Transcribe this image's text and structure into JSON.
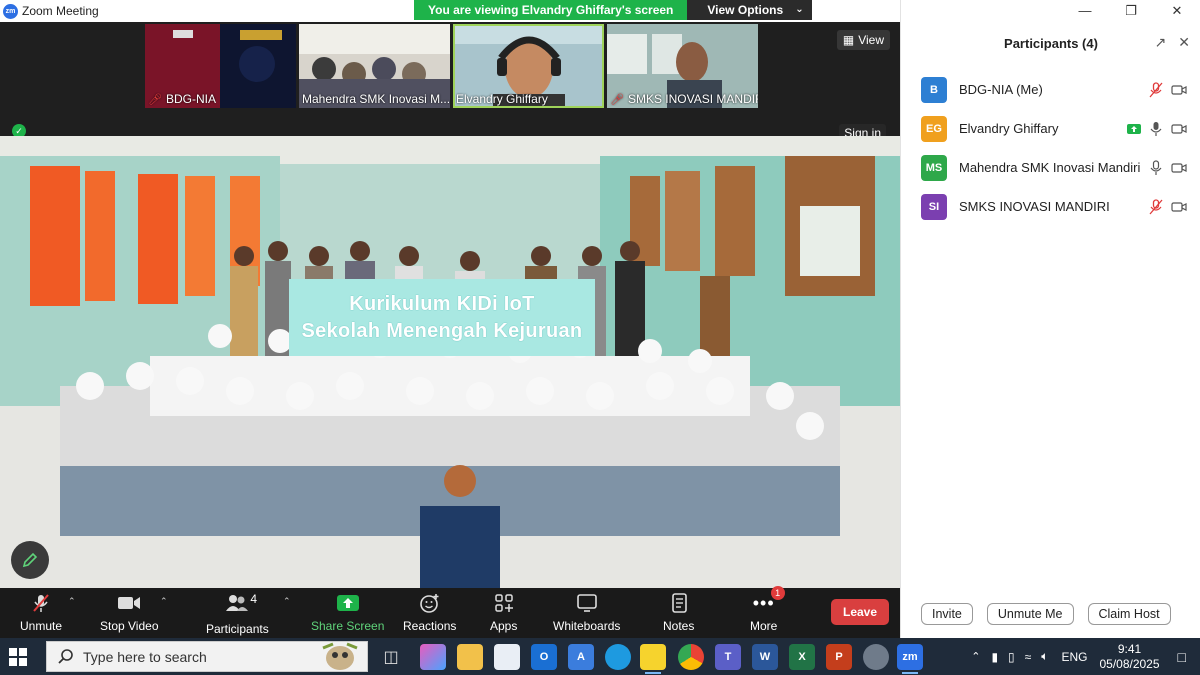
{
  "window": {
    "title": "Zoom Meeting"
  },
  "share_banner": {
    "message": "You are viewing Elvandry Ghiffary's screen",
    "view_options": "View Options"
  },
  "thumbnails": [
    {
      "name": "BDG-NIA",
      "muted": true
    },
    {
      "name": "Mahendra SMK Inovasi M...",
      "muted": false
    },
    {
      "name": "Elvandry Ghiffary",
      "muted": false,
      "active": true
    },
    {
      "name": "SMKS INOVASI MANDIRI...",
      "muted": true
    }
  ],
  "view_button": "View",
  "sign_in": "Sign in",
  "slide": {
    "line1": "Kurikulum KIDi IoT",
    "line2": "Sekolah Menengah Kejuruan"
  },
  "toolbar": {
    "unmute": "Unmute",
    "stop_video": "Stop Video",
    "participants": "Participants",
    "participants_count": "4",
    "share_screen": "Share Screen",
    "reactions": "Reactions",
    "apps": "Apps",
    "whiteboards": "Whiteboards",
    "notes": "Notes",
    "more": "More",
    "more_badge": "1",
    "leave": "Leave"
  },
  "panel": {
    "title": "Participants (4)",
    "participants": [
      {
        "initials": "B",
        "name": "BDG-NIA (Me)",
        "color": "#2d7fd3",
        "mic": "muted",
        "sharing": false
      },
      {
        "initials": "EG",
        "name": "Elvandry Ghiffary",
        "color": "#f0a01e",
        "mic": "on",
        "sharing": true
      },
      {
        "initials": "MS",
        "name": "Mahendra SMK Inovasi Mandiri",
        "color": "#2ea84a",
        "mic": "on",
        "sharing": false
      },
      {
        "initials": "SI",
        "name": "SMKS INOVASI MANDIRI",
        "color": "#7b3fb0",
        "mic": "muted",
        "sharing": false
      }
    ],
    "buttons": {
      "invite": "Invite",
      "unmute_me": "Unmute Me",
      "claim_host": "Claim Host"
    }
  },
  "taskbar": {
    "search_placeholder": "Type here to search",
    "language": "ENG",
    "time": "9:41",
    "date": "05/08/2025"
  },
  "colors": {
    "zoom_green": "#1eb34a",
    "leave_red": "#d93f3f",
    "toolbar_bg": "#1a1a1a"
  }
}
